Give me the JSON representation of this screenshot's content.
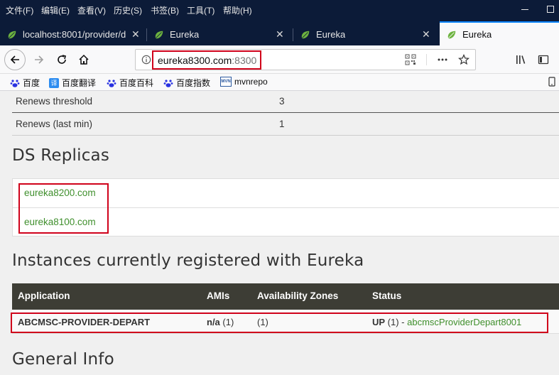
{
  "menubar": {
    "items": [
      "文件(F)",
      "编辑(E)",
      "查看(V)",
      "历史(S)",
      "书签(B)",
      "工具(T)",
      "帮助(H)"
    ]
  },
  "tabs": [
    {
      "title": "localhost:8001/provider/d",
      "active": false
    },
    {
      "title": "Eureka",
      "active": false
    },
    {
      "title": "Eureka",
      "active": false
    },
    {
      "title": "Eureka",
      "active": true
    }
  ],
  "navbar": {
    "url_host": "eureka8300.com",
    "url_port": ":8300"
  },
  "bookmarks": [
    "百度",
    "百度翻译",
    "百度百科",
    "百度指数",
    "mvnrepo"
  ],
  "status_rows": [
    {
      "key": "Renews threshold",
      "value": "3"
    },
    {
      "key": "Renews (last min)",
      "value": "1"
    }
  ],
  "replicas": {
    "heading": "DS Replicas",
    "links": [
      "eureka8200.com",
      "eureka8100.com"
    ]
  },
  "instances": {
    "heading": "Instances currently registered with Eureka",
    "columns": [
      "Application",
      "AMIs",
      "Availability Zones",
      "Status"
    ],
    "rows": [
      {
        "application": "ABCMSC-PROVIDER-DEPART",
        "amis_bold": "n/a",
        "amis_count": " (1)",
        "zones": "(1)",
        "status_bold": "UP",
        "status_count": " (1) - ",
        "status_link": "abcmscProviderDepart8001"
      }
    ]
  },
  "general": {
    "heading": "General Info"
  },
  "colors": {
    "chrome_dark": "#0c1b38",
    "link_green": "#3f8f2c",
    "table_header": "#3d3d35",
    "highlight_red": "#d0021b",
    "tab_accent": "#0a84ff"
  }
}
